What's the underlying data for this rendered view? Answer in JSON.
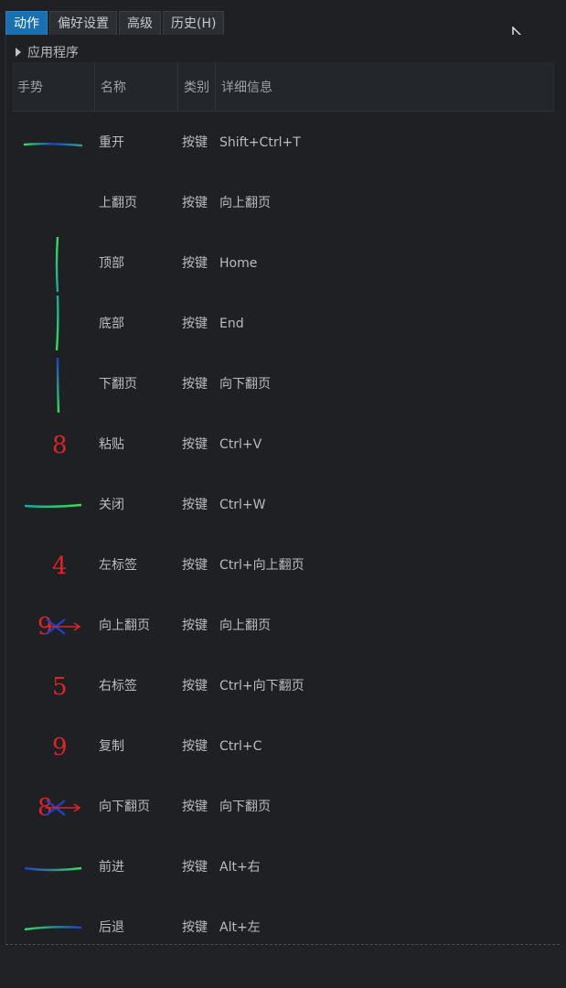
{
  "tabs": [
    {
      "label": "动作",
      "active": true
    },
    {
      "label": "偏好设置",
      "active": false
    },
    {
      "label": "高级",
      "active": false
    },
    {
      "label": "历史(H)",
      "active": false
    }
  ],
  "section": {
    "label": "应用程序"
  },
  "columns": {
    "gesture": "手势",
    "name": "名称",
    "type": "类别",
    "detail": "详细信息"
  },
  "rows": [
    {
      "name": "重开",
      "type": "按键",
      "detail": "Shift+Ctrl+T",
      "gesture_icon": "stroke-right"
    },
    {
      "name": "上翻页",
      "type": "按键",
      "detail": "向上翻页",
      "gesture_icon": "stroke-up"
    },
    {
      "name": "顶部",
      "type": "按键",
      "detail": "Home",
      "gesture_icon": "stroke-up-long"
    },
    {
      "name": "底部",
      "type": "按键",
      "detail": "End",
      "gesture_icon": "stroke-down-long"
    },
    {
      "name": "下翻页",
      "type": "按键",
      "detail": "向下翻页",
      "gesture_icon": "stroke-down"
    },
    {
      "name": "粘贴",
      "type": "按键",
      "detail": "Ctrl+V",
      "gesture_icon": "glyph-8"
    },
    {
      "name": "关闭",
      "type": "按键",
      "detail": "Ctrl+W",
      "gesture_icon": "stroke-right-green"
    },
    {
      "name": "左标签",
      "type": "按键",
      "detail": "Ctrl+向上翻页",
      "gesture_icon": "glyph-4"
    },
    {
      "name": "向上翻页",
      "type": "按键",
      "detail": "向上翻页",
      "gesture_icon": "glyph-9-arrow"
    },
    {
      "name": "右标签",
      "type": "按键",
      "detail": "Ctrl+向下翻页",
      "gesture_icon": "glyph-5"
    },
    {
      "name": "复制",
      "type": "按键",
      "detail": "Ctrl+C",
      "gesture_icon": "glyph-9"
    },
    {
      "name": "向下翻页",
      "type": "按键",
      "detail": "向下翻页",
      "gesture_icon": "glyph-8-arrow"
    },
    {
      "name": "前进",
      "type": "按键",
      "detail": "Alt+右",
      "gesture_icon": "stroke-right-blue"
    },
    {
      "name": "后退",
      "type": "按键",
      "detail": "Alt+左",
      "gesture_icon": "stroke-left-green"
    }
  ],
  "colors": {
    "accent": "#1c6fae",
    "glyph": "#d8262a",
    "stroke_green": "#33e055",
    "stroke_blue": "#2040c8"
  }
}
